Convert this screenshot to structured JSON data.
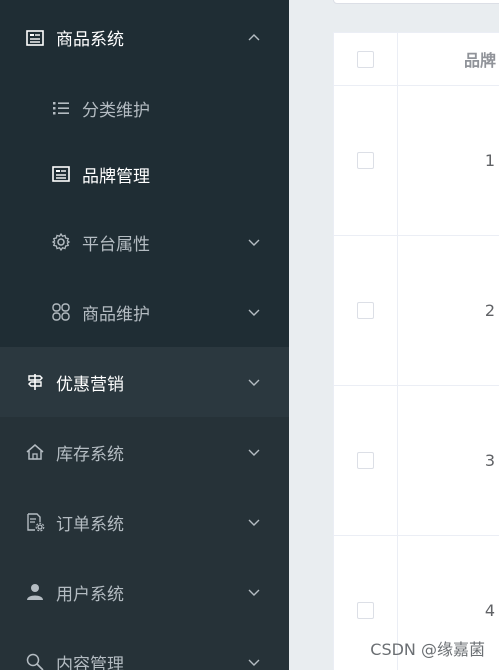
{
  "sidebar": {
    "groups": [
      {
        "label": "商品系统",
        "icon": "document-list-icon",
        "expanded": true,
        "children": [
          {
            "label": "分类维护",
            "icon": "list-icon"
          },
          {
            "label": "品牌管理",
            "icon": "document-list-icon",
            "active": true
          },
          {
            "label": "平台属性",
            "icon": "gear-icon"
          },
          {
            "label": "商品维护",
            "icon": "grid-icon"
          }
        ]
      },
      {
        "label": "优惠营销",
        "icon": "signpost-icon"
      },
      {
        "label": "库存系统",
        "icon": "home-icon"
      },
      {
        "label": "订单系统",
        "icon": "document-gear-icon"
      },
      {
        "label": "用户系统",
        "icon": "user-icon"
      },
      {
        "label": "内容管理",
        "icon": "search-icon"
      }
    ]
  },
  "table": {
    "header": {
      "brand_col": "品牌"
    },
    "rows": [
      {
        "id": "1"
      },
      {
        "id": "2"
      },
      {
        "id": "3"
      },
      {
        "id": "4"
      }
    ]
  },
  "watermark": "CSDN @缘嘉菌",
  "colors": {
    "sidebar_bg": "#263238",
    "submenu_bg": "#1f2d34",
    "hover_bg": "#2b383f",
    "active_text": "#ffffff",
    "muted_text": "#b4bcc2"
  }
}
